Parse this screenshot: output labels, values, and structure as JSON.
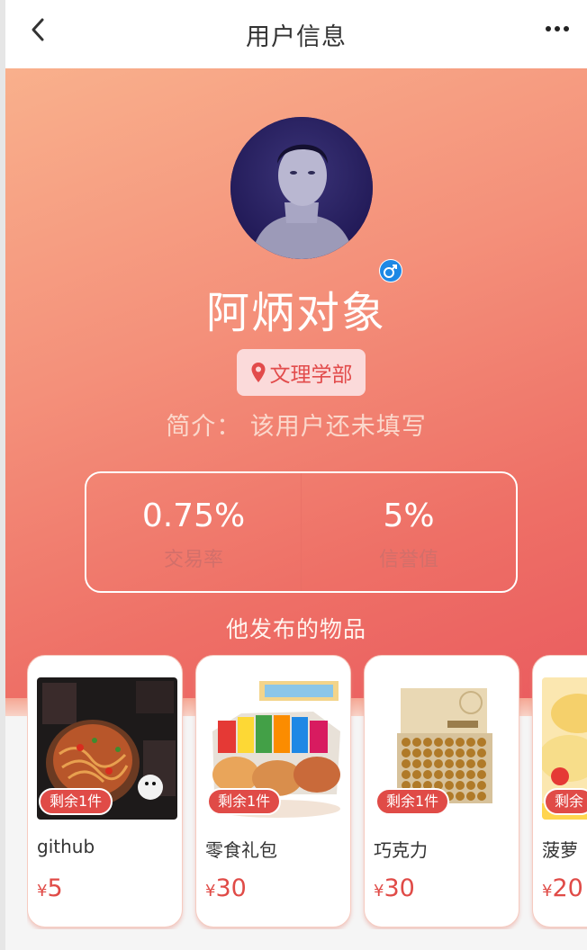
{
  "navbar": {
    "title": "用户信息"
  },
  "profile": {
    "name": "阿炳对象",
    "location": "文理学部",
    "intro": "简介： 该用户还未填写",
    "gender_symbol": "♂"
  },
  "stats": [
    {
      "value": "0.75%",
      "label": "交易率"
    },
    {
      "value": "5%",
      "label": "信誉值"
    }
  ],
  "section_title": "他发布的物品",
  "products": [
    {
      "name": "github",
      "stock": "剩余1件",
      "currency": "¥",
      "price": "5"
    },
    {
      "name": "零食礼包",
      "stock": "剩余1件",
      "currency": "¥",
      "price": "30"
    },
    {
      "name": "巧克力",
      "stock": "剩余1件",
      "currency": "¥",
      "price": "30"
    },
    {
      "name": "菠萝",
      "stock": "剩余",
      "currency": "¥",
      "price": "20"
    }
  ],
  "icons": {
    "back": "chevron-left-icon",
    "more": "more-dots-icon",
    "location": "map-pin-icon",
    "gender": "male-icon"
  },
  "colors": {
    "accent": "#e04b47",
    "gradient_start": "#f9b08c",
    "gradient_end": "#ea5c5f",
    "gender_blue": "#1e88e5"
  }
}
